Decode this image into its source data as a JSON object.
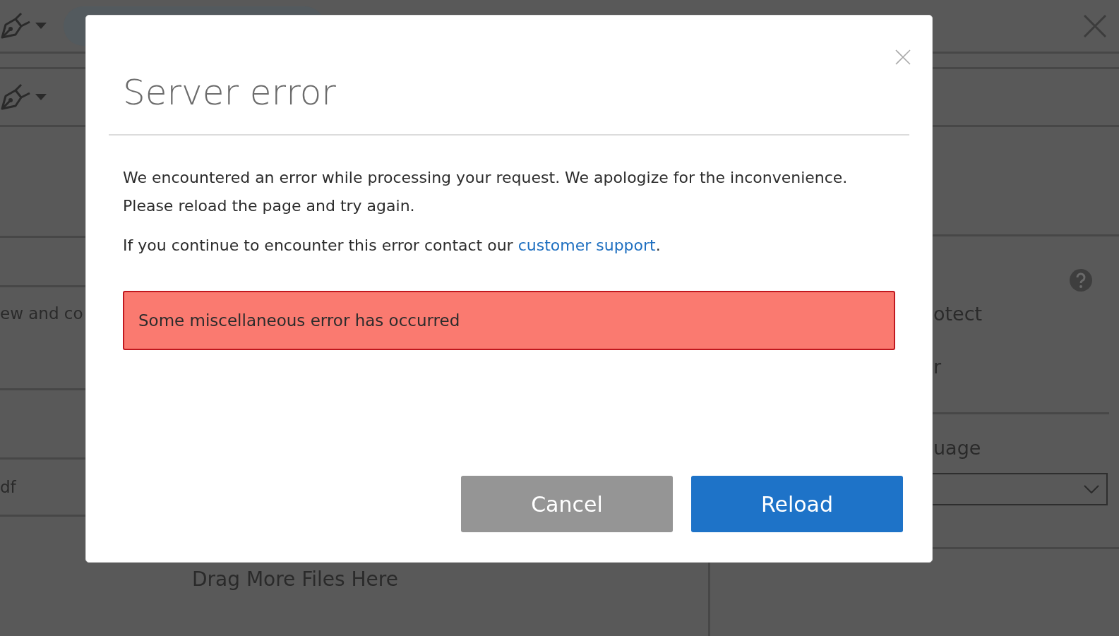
{
  "background": {
    "left_texts": [
      "ew and co",
      "df"
    ],
    "drop_hint": "Drag More Files Here",
    "right_texts": [
      "otect",
      "r"
    ],
    "right_label": "uage"
  },
  "dialog": {
    "title": "Server error",
    "message": "We encountered an error while processing your request. We apologize for the inconvenience. Please reload the page and try again.",
    "support": {
      "before": "If you continue to encounter this error contact our ",
      "link": "customer support",
      "after": "."
    },
    "alert": "Some miscellaneous error has occurred",
    "buttons": [
      {
        "label": "Cancel",
        "kind": "secondary"
      },
      {
        "label": "Reload",
        "kind": "primary"
      }
    ]
  }
}
